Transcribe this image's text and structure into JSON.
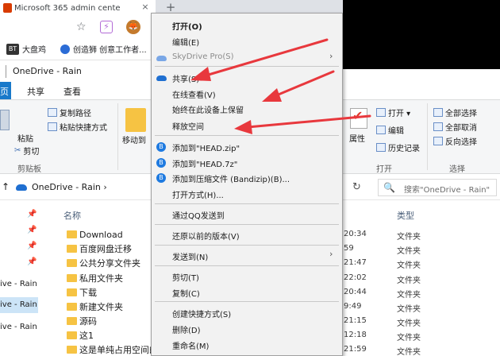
{
  "browser": {
    "tab_title": "Microsoft 365 admin cente",
    "tab_close": "×",
    "new_tab": "+",
    "star_glyph": "☆",
    "ext1_glyph": "⚡",
    "ext2_glyph": "🦊",
    "bookmarks": [
      {
        "badge": "BT",
        "label": "大盘鸡"
      },
      {
        "label": "创造狮 创意工作者..."
      }
    ]
  },
  "explorer": {
    "title": "OneDrive - Rain",
    "ribbon_tabs": {
      "file_abbr": "页",
      "share": "共享",
      "view": "查看"
    },
    "ribbon": {
      "copy_path": "复制路径",
      "paste_shortcut": "粘贴快捷方式",
      "paste": "粘贴",
      "cut": "剪切",
      "clipboard_group": "剪贴板",
      "move_to": "移动到",
      "properties": "属性",
      "open_dropdown": "打开 ▾",
      "edit": "编辑",
      "history": "历史记录",
      "open_group": "打开",
      "select_all": "全部选择",
      "select_none": "全部取消",
      "invert_select": "反向选择",
      "select_group": "选择"
    },
    "nav": {
      "back_glyph": "↑",
      "breadcrumb": "OneDrive - Rain  ›",
      "refresh_glyph": "↻",
      "search_placeholder": "搜索\"OneDrive - Rain\"",
      "search_glyph": "🔍"
    },
    "left_pane": [
      "ive - Rain",
      "ive - Rain",
      "ive - Rain"
    ],
    "pin_glyph": "📌",
    "columns": {
      "name": "名称",
      "type": "类型"
    },
    "files": [
      {
        "name": "Download",
        "time": "20:34",
        "type": "文件夹"
      },
      {
        "name": "百度网盘迁移",
        "time": "59",
        "type": "文件夹"
      },
      {
        "name": "公共分享文件夹",
        "time": "21:47",
        "type": "文件夹"
      },
      {
        "name": "私用文件夹",
        "time": "22:02",
        "type": "文件夹"
      },
      {
        "name": "下载",
        "time": "20:44",
        "type": "文件夹"
      },
      {
        "name": "新建文件夹",
        "time": "9:49",
        "type": "文件夹"
      },
      {
        "name": "源码",
        "time": "21:15",
        "type": "文件夹"
      },
      {
        "name": "这1",
        "time": "12:18",
        "type": "文件夹"
      },
      {
        "name": "这是单纯占用空间的",
        "time": "21:59",
        "type": "文件夹"
      }
    ]
  },
  "context_menu": {
    "chevron": "›",
    "open": "打开(O)",
    "edit": "编辑(E)",
    "skydrive": "SkyDrive Pro(S)",
    "share": "共享(S)",
    "view_online": "在线查看(V)",
    "keep_on_device": "始终在此设备上保留",
    "free_space": "释放空间",
    "add_zip": "添加到\"HEAD.zip\"",
    "add_7z": "添加到\"HEAD.7z\"",
    "add_archive": "添加到压缩文件 (Bandizip)(B)...",
    "open_with": "打开方式(H)...",
    "send_qq": "通过QQ发送到",
    "restore_previous": "还原以前的版本(V)",
    "send_to": "发送到(N)",
    "cut": "剪切(T)",
    "copy": "复制(C)",
    "create_shortcut": "创建快捷方式(S)",
    "delete": "删除(D)",
    "rename": "重命名(M)",
    "bz_glyph": "B"
  },
  "colors": {
    "annotation_arrow": "#e8383d",
    "accent": "#1979ca",
    "folder": "#f6c343"
  }
}
